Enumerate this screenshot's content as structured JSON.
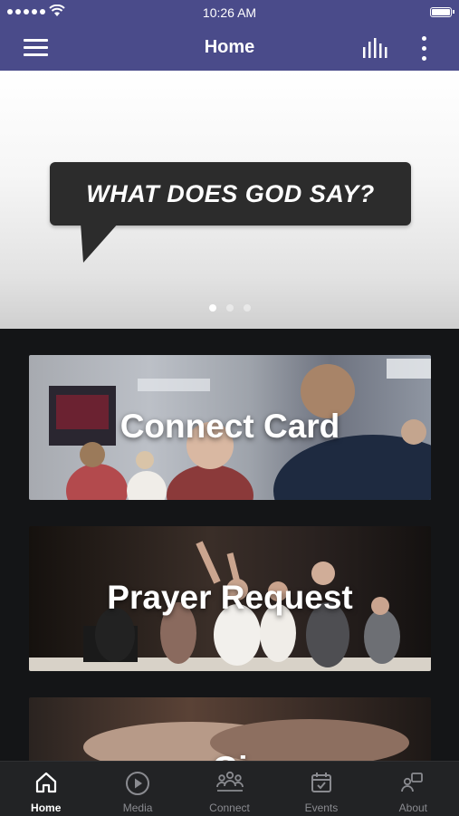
{
  "status_bar": {
    "time": "10:26 AM"
  },
  "header": {
    "title": "Home"
  },
  "hero": {
    "bubble_text": "WHAT DOES GOD SAY?",
    "page_count": 3,
    "active_page": 0
  },
  "cards": [
    {
      "label": "Connect Card"
    },
    {
      "label": "Prayer Request"
    },
    {
      "label": "Gi"
    }
  ],
  "tabs": [
    {
      "label": "Home",
      "icon": "home-icon",
      "active": true
    },
    {
      "label": "Media",
      "icon": "play-icon",
      "active": false
    },
    {
      "label": "Connect",
      "icon": "people-icon",
      "active": false
    },
    {
      "label": "Events",
      "icon": "calendar-icon",
      "active": false
    },
    {
      "label": "About",
      "icon": "about-icon",
      "active": false
    }
  ],
  "colors": {
    "header_bg": "#4a4b8a",
    "content_bg": "#141517",
    "tabbar_bg": "#222325",
    "tab_active": "#ffffff",
    "tab_inactive": "#8a8b90"
  }
}
